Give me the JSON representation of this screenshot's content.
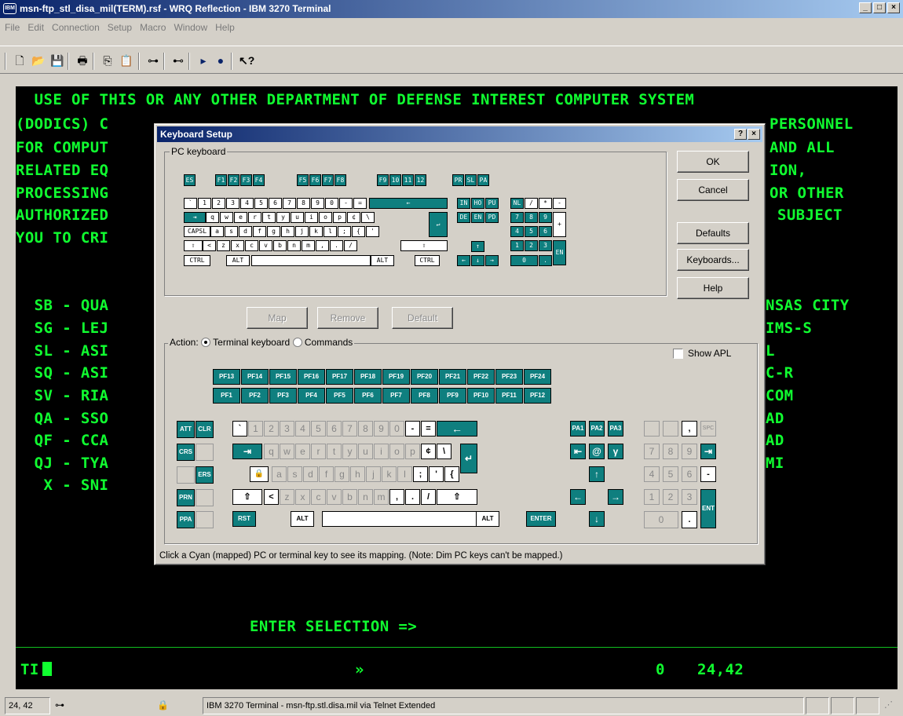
{
  "window": {
    "title": "msn-ftp_stl_disa_mil(TERM).rsf - WRQ Reflection - IBM 3270 Terminal",
    "app_icon": "IBM",
    "controls": [
      "_",
      "□",
      "×"
    ]
  },
  "menu": [
    "File",
    "Edit",
    "Connection",
    "Setup",
    "Macro",
    "Window",
    "Help"
  ],
  "toolbar": {
    "icons": [
      "new-icon",
      "open-icon",
      "save-icon",
      "print-icon",
      "copy-icon",
      "paste-icon",
      "connect-icon",
      "disconnect-icon",
      "play-macro-icon",
      "record-macro-icon",
      "context-help-icon"
    ]
  },
  "terminal": {
    "lines": [
      "  USE OF THIS OR ANY OTHER DEPARTMENT OF DEFENSE INTEREST COMPUTER SYSTEM",
      "(DODICS) C",
      "FOR COMPUT",
      "RELATED EQ",
      "PROCESSING",
      "AUTHORIZED",
      "YOU TO CRI",
      "  SB - QUA",
      "  SG - LEJ",
      "  SL - ASI",
      "  SQ - ASI",
      "  SV - RIA",
      "  QA - SSO",
      "  QF - CCA",
      "  QJ - TYA",
      "   X - SNI"
    ],
    "right_fragments": [
      "PERSONNEL",
      "AND ALL",
      "ION,",
      "OR OTHER",
      "SUBJECT",
      "NSAS CITY",
      "IMS-S",
      "L",
      "C-R",
      "COM",
      "AD",
      "AD",
      "MI"
    ],
    "prompt": "ENTER SELECTION =>",
    "oia": {
      "left": "TI",
      "center": "»",
      "count": "0",
      "cursor": "24,42"
    },
    "colors": {
      "fg": "#10ff30",
      "bg": "#000000"
    }
  },
  "statusbar": {
    "position": "24, 42",
    "lock_icon": "lock-icon",
    "message": "IBM 3270 Terminal - msn-ftp.stl.disa.mil via Telnet Extended"
  },
  "dialog": {
    "title": "Keyboard Setup",
    "help_btn": "?",
    "close_btn": "×",
    "pc_group": "PC keyboard",
    "buttons": {
      "ok": "OK",
      "cancel": "Cancel",
      "defaults": "Defaults",
      "keyboards": "Keyboards...",
      "help": "Help"
    },
    "map_buttons": {
      "map": "Map",
      "remove": "Remove",
      "default": "Default"
    },
    "action_label": "Action:",
    "radio_terminal": "Terminal keyboard",
    "radio_commands": "Commands",
    "show_apl": "Show APL",
    "hint": "Click a Cyan (mapped) PC or terminal key to see its mapping. (Note: Dim PC keys can't be mapped.)",
    "accent": "#0f7f7f"
  },
  "pc_keys": {
    "func": [
      "ES",
      "F1",
      "F2",
      "F3",
      "F4",
      "F5",
      "F6",
      "F7",
      "F8",
      "F9",
      "10",
      "11",
      "12",
      "PR",
      "SL",
      "PA"
    ],
    "row1": [
      "`",
      "1",
      "2",
      "3",
      "4",
      "5",
      "6",
      "7",
      "8",
      "9",
      "0",
      "-",
      "=",
      "←"
    ],
    "row2": [
      "⇥",
      "q",
      "w",
      "e",
      "r",
      "t",
      "y",
      "u",
      "i",
      "o",
      "p",
      "¢",
      "\\",
      "↵"
    ],
    "row3": [
      "CAPSL",
      "a",
      "s",
      "d",
      "f",
      "g",
      "h",
      "j",
      "k",
      "l",
      ";",
      "{",
      "'"
    ],
    "row4": [
      "⇧",
      "<",
      "z",
      "x",
      "c",
      "v",
      "b",
      "n",
      "m",
      ",",
      ".",
      "/",
      "⇧"
    ],
    "row5": [
      "CTRL",
      "ALT",
      "ALT",
      "CTRL"
    ],
    "edit": [
      "IN",
      "HO",
      "PU",
      "DE",
      "EN",
      "PD"
    ],
    "arrows": [
      "↑",
      "←",
      "↓",
      "→"
    ],
    "numpad": [
      "NL",
      "/",
      "*",
      "-",
      "7",
      "8",
      "9",
      "+",
      "4",
      "5",
      "6",
      "1",
      "2",
      "3",
      "EN",
      "0",
      "."
    ]
  },
  "term_keys": {
    "pf_top": [
      "PF13",
      "PF14",
      "PF15",
      "PF16",
      "PF17",
      "PF18",
      "PF19",
      "PF20",
      "PF21",
      "PF22",
      "PF23",
      "PF24"
    ],
    "pf_bottom": [
      "PF1",
      "PF2",
      "PF3",
      "PF4",
      "PF5",
      "PF6",
      "PF7",
      "PF8",
      "PF9",
      "PF10",
      "PF11",
      "PF12"
    ],
    "left": [
      "ATT",
      "CLR",
      "CRS",
      "ERS",
      "PRN",
      "PPA"
    ],
    "row1": [
      "`",
      "1",
      "2",
      "3",
      "4",
      "5",
      "6",
      "7",
      "8",
      "9",
      "0",
      "-",
      "=",
      "←"
    ],
    "row2": [
      "⇥",
      "q",
      "w",
      "e",
      "r",
      "t",
      "y",
      "u",
      "i",
      "o",
      "p",
      "¢",
      "\\",
      "↵"
    ],
    "row3": [
      "🔒",
      "a",
      "s",
      "d",
      "f",
      "g",
      "h",
      "j",
      "k",
      "l",
      ";",
      "'",
      "{"
    ],
    "row4": [
      "⇧",
      "<",
      "z",
      "x",
      "c",
      "v",
      "b",
      "n",
      "m",
      ",",
      ".",
      "/",
      "⇧"
    ],
    "row5": [
      "RST",
      "ALT",
      "ALT",
      "ENTER"
    ],
    "pa": [
      "PA1",
      "PA2",
      "PA3"
    ],
    "nav": [
      "⇤",
      "@",
      "γ",
      "↑",
      "←",
      "→",
      "↓"
    ],
    "numpad": [
      ",",
      "SPC",
      "7",
      "8",
      "9",
      "⇥",
      "4",
      "5",
      "6",
      "-",
      "1",
      "2",
      "3",
      "ENT",
      "0",
      "."
    ]
  }
}
